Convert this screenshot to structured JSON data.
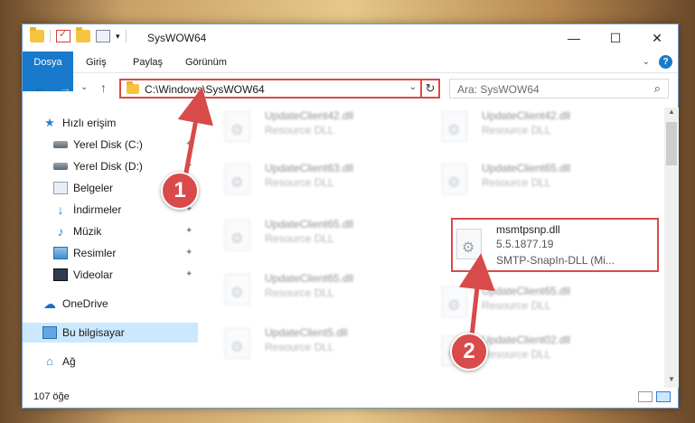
{
  "window": {
    "title": "SysWOW64",
    "minimize": "—",
    "maximize": "☐",
    "close": "✕"
  },
  "ribbon": {
    "tabs": [
      "Dosya",
      "Giriş",
      "Paylaş",
      "Görünüm"
    ],
    "collapse": "⌄",
    "help": "?"
  },
  "nav": {
    "back": "←",
    "forward": "→",
    "recent": "⌄",
    "up": "↑",
    "address": "C:\\Windows\\SysWOW64",
    "address_dropdown": "⌄",
    "refresh": "↻",
    "search_placeholder": "Ara: SysWOW64",
    "search_icon": "⌕"
  },
  "sidebar": {
    "items": [
      {
        "label": "Hızlı erişim",
        "icon": "star-icon"
      },
      {
        "label": "Yerel Disk (C:)",
        "icon": "disk-icon",
        "pinned": true
      },
      {
        "label": "Yerel Disk (D:)",
        "icon": "disk-icon",
        "pinned": true
      },
      {
        "label": "Belgeler",
        "icon": "document-icon",
        "pinned": true
      },
      {
        "label": "İndirmeler",
        "icon": "download-icon",
        "pinned": true
      },
      {
        "label": "Müzik",
        "icon": "music-icon",
        "pinned": true
      },
      {
        "label": "Resimler",
        "icon": "picture-icon",
        "pinned": true
      },
      {
        "label": "Videolar",
        "icon": "video-icon",
        "pinned": true
      },
      {
        "label": "OneDrive",
        "icon": "cloud-icon"
      },
      {
        "label": "Bu bilgisayar",
        "icon": "computer-icon",
        "selected": true
      },
      {
        "label": "Ağ",
        "icon": "network-icon"
      }
    ],
    "pin_glyph": "📌"
  },
  "files": {
    "left": [
      {
        "name": "UpdateClient42.dll",
        "type": "Resource DLL"
      },
      {
        "name": "UpdateClient63.dll",
        "type": "Resource DLL"
      },
      {
        "name": "UpdateClient65.dll",
        "type": "Resource DLL"
      },
      {
        "name": "UpdateClient65.dll",
        "type": "Resource DLL"
      },
      {
        "name": "UpdateClient5.dll",
        "type": "Resource DLL"
      }
    ],
    "right": [
      {
        "name": "UpdateClient42.dll",
        "type": "Resource DLL"
      },
      {
        "name": "UpdateClient65.dll",
        "type": "Resource DLL"
      },
      {
        "name": "UpdateClient65.dll",
        "type": "Resource DLL"
      },
      {
        "name": "UpdateClient02.dll",
        "type": "Resource DLL"
      }
    ],
    "highlighted": {
      "name": "msmtpsnp.dll",
      "version": "5.5.1877.19",
      "description": "SMTP-SnapIn-DLL (Mi..."
    }
  },
  "scroll": {
    "up": "▲",
    "down": "▼"
  },
  "status": {
    "count": "107 öğe"
  },
  "annotations": {
    "step1": "1",
    "step2": "2",
    "color": "#d94a4a"
  }
}
